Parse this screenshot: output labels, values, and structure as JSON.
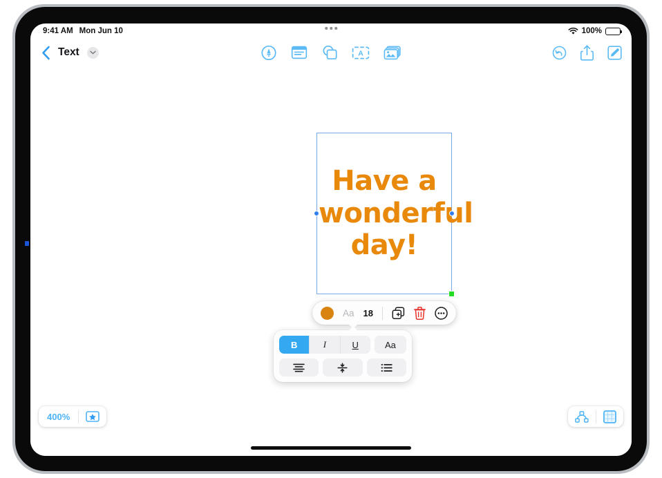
{
  "status_bar": {
    "time": "9:41 AM",
    "date": "Mon Jun 10",
    "wifi_icon": "wifi-icon",
    "battery_percent": "100%",
    "battery_icon": "battery-full-icon",
    "multitask_icon": "multitasking-dots-icon"
  },
  "nav_bar": {
    "back_icon": "chevron-left-icon",
    "title": "Text",
    "title_menu_icon": "chevron-down-icon",
    "center_tools": [
      {
        "name": "draw-tool",
        "icon": "pen-in-circle-icon"
      },
      {
        "name": "media-tool",
        "icon": "text-card-icon"
      },
      {
        "name": "shapes-tool",
        "icon": "shapes-icon"
      },
      {
        "name": "text-box-tool",
        "icon": "text-box-a-icon"
      },
      {
        "name": "photos-tool",
        "icon": "photo-stack-icon"
      }
    ],
    "right_tools": [
      {
        "name": "undo-button",
        "icon": "undo-arrow-circle-icon"
      },
      {
        "name": "share-button",
        "icon": "share-up-arrow-icon"
      },
      {
        "name": "compose-button",
        "icon": "pencil-square-icon"
      }
    ]
  },
  "canvas": {
    "text_object": {
      "content": "Have a wonderful day!",
      "text_color": "#e8890c",
      "selection_border_color": "#7aa7e8",
      "handle_color": "#2f7ff0",
      "resize_handle_color": "#22dd22"
    }
  },
  "context_toolbar": {
    "color_swatch": {
      "name": "text-color-swatch",
      "color": "#d98310"
    },
    "font_face_label": "Aa",
    "font_size": "18",
    "duplicate_icon": "duplicate-icon",
    "delete_icon": "trash-icon",
    "delete_color": "#e8332a",
    "more_icon": "more-ellipsis-circle-icon"
  },
  "format_panel": {
    "row_one": [
      {
        "name": "bold-button",
        "label": "B",
        "active": true
      },
      {
        "name": "italic-button",
        "label": "I",
        "active": false
      },
      {
        "name": "underline-button",
        "label": "U",
        "active": false
      }
    ],
    "font_style_button": {
      "name": "font-style-button",
      "label": "Aa"
    },
    "row_two": [
      {
        "name": "align-center-button",
        "icon": "align-center-icon"
      },
      {
        "name": "vertical-align-center-button",
        "icon": "vertical-align-center-icon"
      },
      {
        "name": "bulleted-list-button",
        "icon": "bulleted-list-icon"
      }
    ],
    "active_color": "#34a9f2"
  },
  "bottom_bar": {
    "zoom_level": "400%",
    "bookmark_icon": "star-in-rectangle-icon",
    "outline_icon": "node-hierarchy-icon",
    "canvas_icon": "grid-square-icon"
  }
}
